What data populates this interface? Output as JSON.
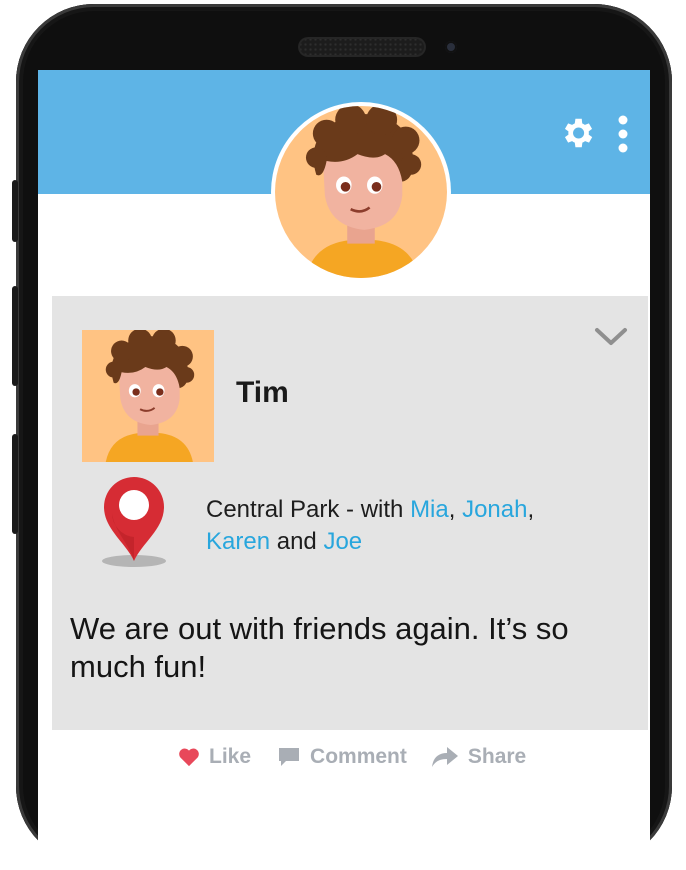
{
  "header": {
    "settings_icon": "gear-icon",
    "menu_icon": "more-vertical-icon",
    "accent_color": "#5eb4e6"
  },
  "post": {
    "author": "Tim",
    "location": {
      "icon": "location-pin-icon",
      "prefix": "Central Park - with ",
      "friends": [
        "Mia",
        "Jonah",
        "Karen",
        "Joe"
      ],
      "sep1": ", ",
      "sep2": ",",
      "and": " and "
    },
    "text": "We are out with friends again. It’s so much fun!",
    "link_color": "#28a6dd"
  },
  "actions": {
    "like": "Like",
    "comment": "Comment",
    "share": "Share"
  }
}
